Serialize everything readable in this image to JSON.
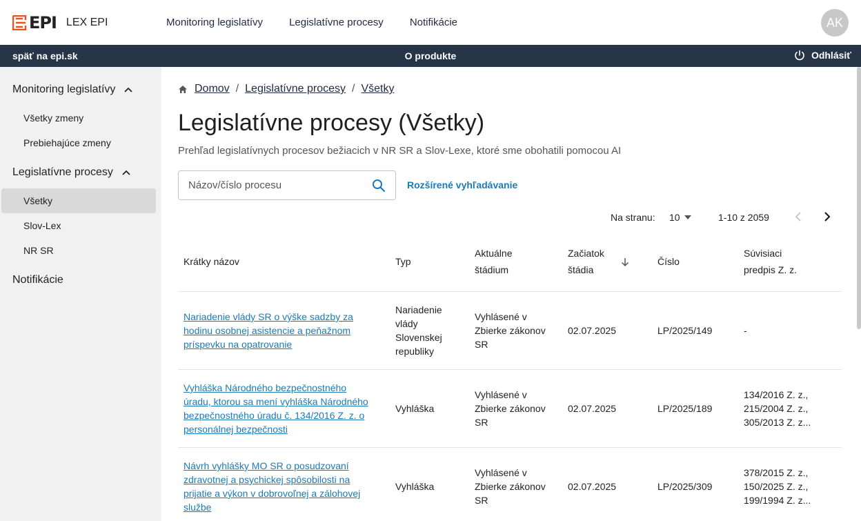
{
  "header": {
    "logo_text": "EPI",
    "product_name": "LEX EPI",
    "nav": [
      "Monitoring legislatívy",
      "Legislatívne procesy",
      "Notifikácie"
    ],
    "avatar_initials": "AK"
  },
  "strip": {
    "back": "späť na epi.sk",
    "about": "O produkte",
    "logout": "Odhlásiť"
  },
  "sidebar": {
    "groups": [
      {
        "label": "Monitoring legislatívy",
        "items": [
          "Všetky zmeny",
          "Prebiehajúce zmeny"
        ]
      },
      {
        "label": "Legislatívne procesy",
        "items": [
          "Všetky",
          "Slov-Lex",
          "NR SR"
        ]
      },
      {
        "label": "Notifikácie",
        "items": []
      }
    ],
    "active_item": "Všetky"
  },
  "breadcrumb": [
    "Domov",
    "Legislatívne procesy",
    "Všetky"
  ],
  "page": {
    "title": "Legislatívne procesy (Všetky)",
    "subtitle": "Prehľad legislatívnych procesov bežiacich v NR SR a Slov-Lexe, ktoré sme obohatili pomocou AI"
  },
  "search": {
    "placeholder": "Názov/číslo procesu",
    "advanced_label": "Rozšírené vyhľadávanie"
  },
  "pagination": {
    "per_page_label": "Na stranu:",
    "per_page_value": "10",
    "range": "1-10 z 2059"
  },
  "table": {
    "headers": {
      "name": "Krátky názov",
      "type": "Typ",
      "stage_1": "Aktuálne",
      "stage_2": "štádium",
      "start_1": "Začiatok",
      "start_2": "štádia",
      "number": "Číslo",
      "related_1": "Súvisiaci",
      "related_2": "predpis Z. z."
    },
    "rows": [
      {
        "name": [
          "Nariadenie vlády SR o výške sadzby za",
          "hodinu osobnej asistencie a peňažnom",
          "príspevku na opatrovanie"
        ],
        "type": [
          "Nariadenie",
          "vlády",
          "Slovenskej",
          "republiky"
        ],
        "stage": [
          "Vyhlásené v",
          "Zbierke zákonov",
          "SR"
        ],
        "date": "02.07.2025",
        "number": "LP/2025/149",
        "related": [
          "-"
        ]
      },
      {
        "name": [
          "Vyhláška Národného bezpečnostného",
          "úradu, ktorou sa mení vyhláška Národného",
          "bezpečnostného úradu č. 134/2016 Z. z. o",
          "personálnej bezpečnosti"
        ],
        "type": [
          "Vyhláška"
        ],
        "stage": [
          "Vyhlásené v",
          "Zbierke zákonov",
          "SR"
        ],
        "date": "02.07.2025",
        "number": "LP/2025/189",
        "related": [
          "134/2016 Z. z.,",
          "215/2004 Z. z.,",
          "305/2013 Z. z..."
        ]
      },
      {
        "name": [
          "Návrh vyhlášky MO SR o posudzovaní",
          "zdravotnej a psychickej spôsobilosti na",
          "prijatie a výkon v dobrovoľnej a zálohovej",
          "službe"
        ],
        "type": [
          "Vyhláška"
        ],
        "stage": [
          "Vyhlásené v",
          "Zbierke zákonov",
          "SR"
        ],
        "date": "02.07.2025",
        "number": "LP/2025/309",
        "related": [
          "378/2015 Z. z.,",
          "150/2025 Z. z.,",
          "199/1994 Z. z..."
        ]
      }
    ]
  },
  "colors": {
    "accent_orange": "#e8541e",
    "strip_bg": "#263548",
    "link_blue": "#1a7ab8",
    "sidebar_bg": "#f1f1f1"
  }
}
